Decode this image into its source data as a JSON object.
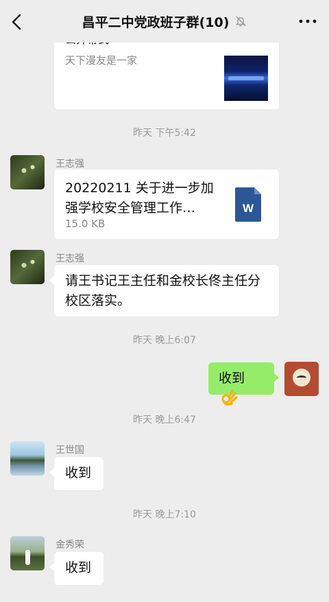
{
  "header": {
    "title": "昌平二中党政班子群(10)",
    "back_icon": "chevron-left-icon",
    "mute_icon": "bell-off-icon",
    "more_icon": "more-dots-icon"
  },
  "messages": {
    "link_card": {
      "title_partial": "公开幕式",
      "source": "天下漫友是一家"
    },
    "time1": "昨天 下午5:42",
    "file_msg": {
      "sender": "王志强",
      "file_name": "20220211 关于进一步加强学校安全管理工作…",
      "file_size": "15.0 KB",
      "file_icon": "word-file-icon"
    },
    "text_msg1": {
      "sender": "王志强",
      "text": "请王书记王主任和金校长佟主任分校区落实。"
    },
    "time2": "昨天 晚上6:07",
    "self_msg": {
      "text": "收到"
    },
    "time3": "昨天 晚上6:47",
    "text_msg2": {
      "sender": "王世国",
      "text": "收到"
    },
    "time4": "昨天 晚上7:10",
    "text_msg3": {
      "sender": "金秀荣",
      "text": "收到"
    }
  },
  "colors": {
    "background": "#ededed",
    "self_bubble": "#95ec69",
    "other_bubble": "#ffffff",
    "word_icon": "#2b5797"
  }
}
